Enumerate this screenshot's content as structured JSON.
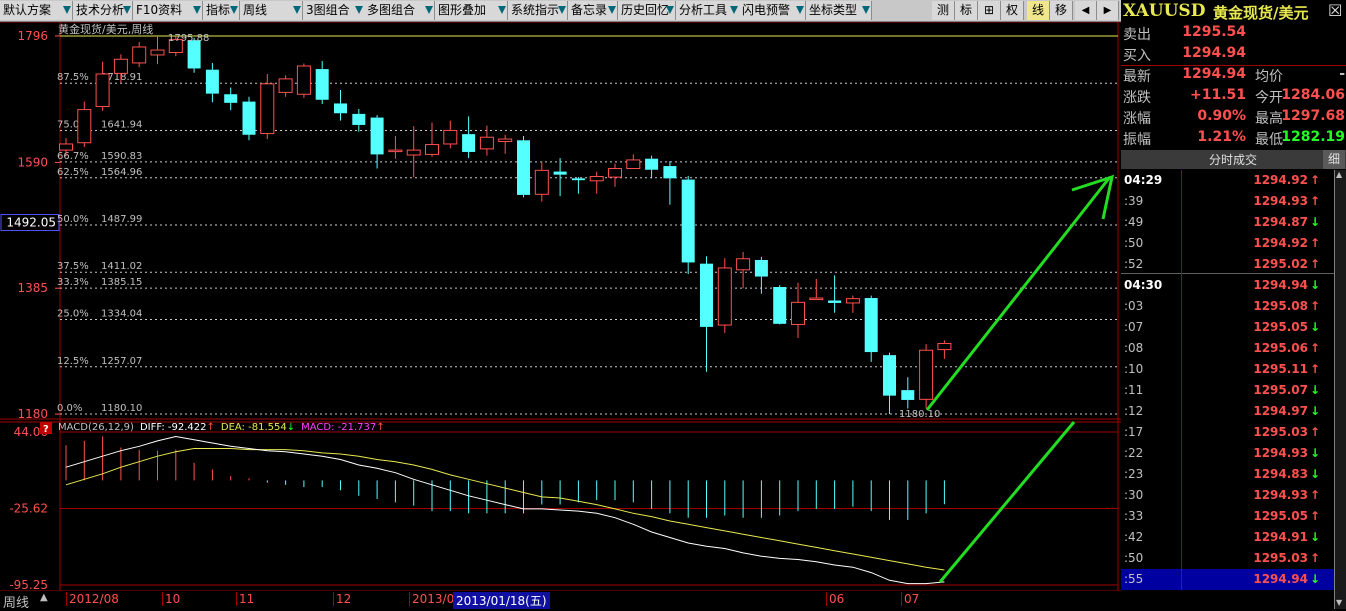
{
  "toolbar": {
    "menus": [
      {
        "label": "默认方案"
      },
      {
        "label": "技术分析"
      },
      {
        "label": "F10资料"
      },
      {
        "label": "指标"
      },
      {
        "label": "周线"
      },
      {
        "label": "3图组合"
      },
      {
        "label": "多图组合"
      },
      {
        "label": "图形叠加"
      },
      {
        "label": "系统指示"
      },
      {
        "label": "备忘录"
      },
      {
        "label": "历史回忆"
      },
      {
        "label": "分析工具"
      },
      {
        "label": "闪电预警"
      },
      {
        "label": "坐标类型"
      }
    ],
    "modes": [
      "测",
      "标",
      "⊞",
      "权",
      "线",
      "移"
    ],
    "active_mode": "线"
  },
  "header": {
    "symbol": "XAUUSD",
    "name": "黄金现货/美元"
  },
  "chart": {
    "overlay_title": "黄金现货/美元,周线",
    "y_labels": [
      "1796",
      "1590",
      "1385",
      "1180"
    ],
    "cursor_price": "1492.05",
    "high_label": "1795.88",
    "low_label": "1180.10",
    "fib_levels": [
      {
        "pct": "87.5%",
        "value": "1718.91"
      },
      {
        "pct": "75.0%",
        "value": "1641.94"
      },
      {
        "pct": "66.7%",
        "value": "1590.83"
      },
      {
        "pct": "62.5%",
        "value": "1564.96"
      },
      {
        "pct": "50.0%",
        "value": "1487.99"
      },
      {
        "pct": "37.5%",
        "value": "1411.02"
      },
      {
        "pct": "33.3%",
        "value": "1385.15"
      },
      {
        "pct": "25.0%",
        "value": "1334.04"
      },
      {
        "pct": "12.5%",
        "value": "1257.07"
      },
      {
        "pct": "0.0%",
        "value": "1180.10"
      }
    ],
    "macd_y_labels": [
      "44.06",
      "-25.62",
      "-95.25"
    ],
    "macd_indicator": {
      "name": "MACD(26,12,9)",
      "diff": "DIFF: -92.422",
      "diff_arrow": "↑",
      "dea": "DEA: -81.554",
      "dea_arrow": "↓",
      "macd": "MACD: -21.737",
      "macd_arrow": "↑"
    },
    "period_label": "周线",
    "x_labels": [
      "2012/08",
      "10",
      "11",
      "12",
      "2013/0",
      "06",
      "07"
    ],
    "x_cursor_label": "2013/01/18(五)",
    "colors": {
      "up": "#ff5050",
      "down": "#54ffff",
      "diff": "#ffffff",
      "dea": "#e8e850",
      "arrow": "#22dd22"
    }
  },
  "quote": {
    "rows": [
      {
        "label": "卖出",
        "value": "1295.54",
        "color": "#ff5050"
      },
      {
        "label": "买入",
        "value": "1294.94",
        "color": "#ff5050"
      },
      {
        "label": "最新",
        "value": "1294.94",
        "color": "#ff5050",
        "label2": "均价",
        "value2": "-",
        "color2": "#c0c0c0"
      },
      {
        "label": "涨跌",
        "value": "+11.51",
        "color": "#ff5050",
        "label2": "今开",
        "value2": "1284.06",
        "color2": "#ff5050"
      },
      {
        "label": "涨幅",
        "value": "0.90%",
        "color": "#ff5050",
        "label2": "最高",
        "value2": "1297.68",
        "color2": "#ff5050"
      },
      {
        "label": "振幅",
        "value": "1.21%",
        "color": "#ff5050",
        "label2": "最低",
        "value2": "1282.19",
        "color2": "#22ff22"
      }
    ]
  },
  "ticks": {
    "title": "分时成交",
    "detail_btn": "细",
    "rows": [
      {
        "time": "04:29",
        "price": "1294.92",
        "dir": "↑"
      },
      {
        "time": ":39",
        "price": "1294.93",
        "dir": "↑"
      },
      {
        "time": ":49",
        "price": "1294.87",
        "dir": "↓"
      },
      {
        "time": ":50",
        "price": "1294.92",
        "dir": "↑"
      },
      {
        "time": ":52",
        "price": "1295.02",
        "dir": "↑"
      },
      {
        "time": "04:30",
        "price": "1294.94",
        "dir": "↓"
      },
      {
        "time": ":03",
        "price": "1295.08",
        "dir": "↑"
      },
      {
        "time": ":07",
        "price": "1295.05",
        "dir": "↓"
      },
      {
        "time": ":08",
        "price": "1295.06",
        "dir": "↑"
      },
      {
        "time": ":10",
        "price": "1295.11",
        "dir": "↑"
      },
      {
        "time": ":11",
        "price": "1295.07",
        "dir": "↓"
      },
      {
        "time": ":12",
        "price": "1294.97",
        "dir": "↓"
      },
      {
        "time": ":17",
        "price": "1295.03",
        "dir": "↑"
      },
      {
        "time": ":22",
        "price": "1294.93",
        "dir": "↓"
      },
      {
        "time": ":23",
        "price": "1294.83",
        "dir": "↓"
      },
      {
        "time": ":30",
        "price": "1294.93",
        "dir": "↑"
      },
      {
        "time": ":33",
        "price": "1295.05",
        "dir": "↑"
      },
      {
        "time": ":42",
        "price": "1294.91",
        "dir": "↓"
      },
      {
        "time": ":50",
        "price": "1295.03",
        "dir": "↑"
      },
      {
        "time": ":55",
        "price": "1294.94",
        "dir": "↓"
      }
    ]
  },
  "chart_data": {
    "type": "candlestick",
    "title": "黄金现货/美元,周线",
    "y_range": [
      1180.1,
      1795.88
    ],
    "candles": [
      {
        "o": 1610,
        "c": 1620,
        "h": 1630,
        "l": 1600
      },
      {
        "o": 1622,
        "c": 1676,
        "h": 1689,
        "l": 1615
      },
      {
        "o": 1681,
        "c": 1734,
        "h": 1754,
        "l": 1674
      },
      {
        "o": 1735,
        "c": 1758,
        "h": 1766,
        "l": 1720
      },
      {
        "o": 1752,
        "c": 1778,
        "h": 1786,
        "l": 1745
      },
      {
        "o": 1765,
        "c": 1773,
        "h": 1795.88,
        "l": 1750
      },
      {
        "o": 1769,
        "c": 1790,
        "h": 1795,
        "l": 1763
      },
      {
        "o": 1789,
        "c": 1743,
        "h": 1793,
        "l": 1736
      },
      {
        "o": 1741,
        "c": 1702,
        "h": 1752,
        "l": 1688
      },
      {
        "o": 1701,
        "c": 1687,
        "h": 1712,
        "l": 1675
      },
      {
        "o": 1689,
        "c": 1635,
        "h": 1697,
        "l": 1626
      },
      {
        "o": 1637,
        "c": 1718,
        "h": 1734,
        "l": 1628
      },
      {
        "o": 1704,
        "c": 1726,
        "h": 1732,
        "l": 1697
      },
      {
        "o": 1701,
        "c": 1747,
        "h": 1751,
        "l": 1695
      },
      {
        "o": 1742,
        "c": 1692,
        "h": 1755,
        "l": 1685
      },
      {
        "o": 1686,
        "c": 1670,
        "h": 1708,
        "l": 1658
      },
      {
        "o": 1669,
        "c": 1651,
        "h": 1677,
        "l": 1640
      },
      {
        "o": 1663,
        "c": 1603,
        "h": 1667,
        "l": 1580
      },
      {
        "o": 1608,
        "c": 1610,
        "h": 1633,
        "l": 1596
      },
      {
        "o": 1602,
        "c": 1610,
        "h": 1649,
        "l": 1566
      },
      {
        "o": 1603,
        "c": 1619,
        "h": 1655,
        "l": 1599
      },
      {
        "o": 1620,
        "c": 1642,
        "h": 1658,
        "l": 1613
      },
      {
        "o": 1636,
        "c": 1607,
        "h": 1665,
        "l": 1597
      },
      {
        "o": 1612,
        "c": 1631,
        "h": 1650,
        "l": 1601
      },
      {
        "o": 1624,
        "c": 1628,
        "h": 1635,
        "l": 1604
      },
      {
        "o": 1626,
        "c": 1537,
        "h": 1633,
        "l": 1533
      },
      {
        "o": 1538,
        "c": 1577,
        "h": 1591,
        "l": 1526
      },
      {
        "o": 1575,
        "c": 1570,
        "h": 1597,
        "l": 1535
      },
      {
        "o": 1564,
        "c": 1561,
        "h": 1566,
        "l": 1539
      },
      {
        "o": 1560,
        "c": 1567,
        "h": 1575,
        "l": 1539
      },
      {
        "o": 1566,
        "c": 1580,
        "h": 1588,
        "l": 1550
      },
      {
        "o": 1580,
        "c": 1594,
        "h": 1603,
        "l": 1581
      },
      {
        "o": 1596,
        "c": 1578,
        "h": 1601,
        "l": 1564
      },
      {
        "o": 1584,
        "c": 1564,
        "h": 1592,
        "l": 1521
      },
      {
        "o": 1562,
        "c": 1427,
        "h": 1568,
        "l": 1408
      },
      {
        "o": 1425,
        "c": 1322,
        "h": 1437,
        "l": 1249
      },
      {
        "o": 1325,
        "c": 1418,
        "h": 1434,
        "l": 1312
      },
      {
        "o": 1415,
        "c": 1433,
        "h": 1444,
        "l": 1385
      },
      {
        "o": 1431,
        "c": 1404,
        "h": 1436,
        "l": 1376
      },
      {
        "o": 1387,
        "c": 1327,
        "h": 1390,
        "l": 1326
      },
      {
        "o": 1326,
        "c": 1362,
        "h": 1394,
        "l": 1304
      },
      {
        "o": 1367,
        "c": 1369,
        "h": 1400,
        "l": 1366
      },
      {
        "o": 1365,
        "c": 1361,
        "h": 1406,
        "l": 1345
      },
      {
        "o": 1361,
        "c": 1368,
        "h": 1373,
        "l": 1345
      },
      {
        "o": 1369,
        "c": 1281,
        "h": 1373,
        "l": 1265
      },
      {
        "o": 1276,
        "c": 1210,
        "h": 1280,
        "l": 1180.1
      },
      {
        "o": 1219,
        "c": 1203,
        "h": 1240,
        "l": 1189
      },
      {
        "o": 1204,
        "c": 1284,
        "h": 1294,
        "l": 1189
      },
      {
        "o": 1285,
        "c": 1295,
        "h": 1300,
        "l": 1270
      }
    ],
    "macd": {
      "y_range": [
        -95.25,
        44.06
      ],
      "diff": [
        12,
        17,
        22,
        27,
        31,
        36,
        40,
        37,
        34,
        31,
        29,
        27,
        26,
        24,
        22,
        19,
        14,
        11,
        7,
        1,
        -4,
        -9,
        -14,
        -18,
        -22,
        -26,
        -26,
        -27,
        -28,
        -30,
        -34,
        -40,
        -47,
        -52,
        -57,
        -60,
        -62,
        -66,
        -69,
        -71,
        -72,
        -74,
        -77,
        -79,
        -84,
        -91,
        -94,
        -94,
        -92.42
      ],
      "dea": [
        -4,
        1,
        6,
        12,
        17,
        22,
        26,
        29,
        29,
        29,
        28,
        28,
        28,
        27,
        25,
        24,
        22,
        19,
        17,
        14,
        10,
        5,
        1,
        -3,
        -7,
        -11,
        -15,
        -16,
        -19,
        -22,
        -26,
        -30,
        -33,
        -37,
        -40,
        -43,
        -46,
        -49,
        -52,
        -55,
        -58,
        -61,
        -64,
        -67,
        -70,
        -73,
        -76,
        -79,
        -81.55
      ],
      "hist": [
        32,
        36,
        40,
        30,
        28,
        27,
        28,
        16,
        10,
        4,
        2,
        -2,
        -4,
        -6,
        -6,
        -9,
        -14,
        -17,
        -20,
        -23,
        -28,
        -28,
        -30,
        -30,
        -30,
        -30,
        -22,
        -22,
        -20,
        -18,
        -18,
        -20,
        -26,
        -30,
        -34,
        -34,
        -32,
        -34,
        -34,
        -32,
        -28,
        -26,
        -26,
        -24,
        -28,
        -36,
        -36,
        -30,
        -21.74
      ]
    }
  }
}
